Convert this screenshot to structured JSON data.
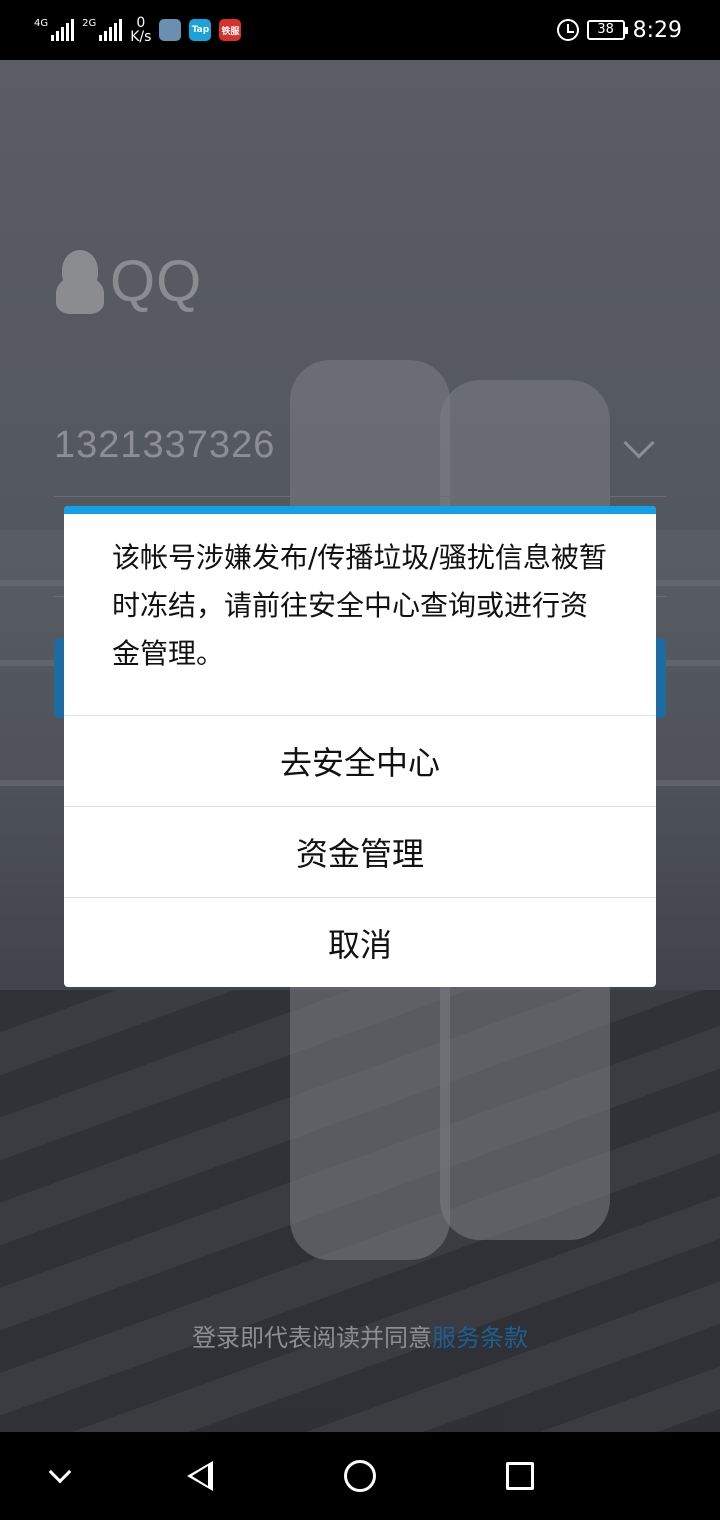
{
  "status_bar": {
    "network_1": "4G",
    "network_2": "2G",
    "speed_value": "0",
    "speed_unit": "K/s",
    "app_icon_2_label": "Tap",
    "app_icon_3_label": "铁服",
    "battery": "38",
    "time": "8:29"
  },
  "login": {
    "logo_text": "QQ",
    "account": "1321337326",
    "agreement_prefix": "登录即代表阅读并同意",
    "agreement_link": "服务条款"
  },
  "dialog": {
    "message": "该帐号涉嫌发布/传播垃圾/骚扰信息被暂时冻结，请前往安全中心查询或进行资金管理。",
    "options": [
      "去安全中心",
      "资金管理",
      "取消"
    ],
    "accent_color": "#12a0e6"
  },
  "nav_bar": {
    "icons": [
      "chevron-down-icon",
      "back-icon",
      "home-icon",
      "recent-apps-icon"
    ]
  }
}
